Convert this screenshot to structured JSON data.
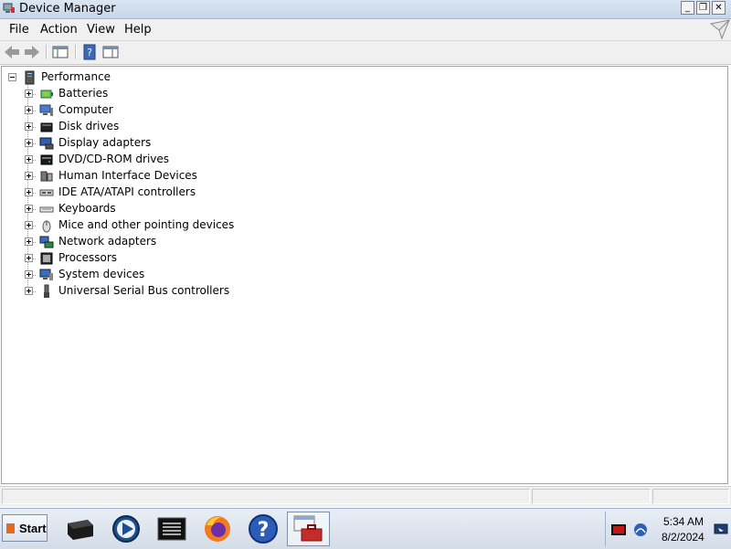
{
  "window": {
    "title": "Device Manager"
  },
  "menu": [
    "File",
    "Action",
    "View",
    "Help"
  ],
  "tree": {
    "root": {
      "label": "Performance",
      "icon": "computer-tower-icon"
    },
    "children": [
      {
        "label": "Batteries",
        "icon": "battery-icon"
      },
      {
        "label": "Computer",
        "icon": "computer-icon"
      },
      {
        "label": "Disk drives",
        "icon": "disk-drive-icon"
      },
      {
        "label": "Display adapters",
        "icon": "display-adapter-icon"
      },
      {
        "label": "DVD/CD-ROM drives",
        "icon": "dvd-drive-icon"
      },
      {
        "label": "Human Interface Devices",
        "icon": "hid-icon"
      },
      {
        "label": "IDE ATA/ATAPI controllers",
        "icon": "ide-controller-icon"
      },
      {
        "label": "Keyboards",
        "icon": "keyboard-icon"
      },
      {
        "label": "Mice and other pointing devices",
        "icon": "mouse-icon"
      },
      {
        "label": "Network adapters",
        "icon": "network-adapter-icon"
      },
      {
        "label": "Processors",
        "icon": "processor-icon"
      },
      {
        "label": "System devices",
        "icon": "system-devices-icon"
      },
      {
        "label": "Universal Serial Bus controllers",
        "icon": "usb-icon"
      }
    ]
  },
  "taskbar": {
    "start_label": "Start",
    "clock_time": "5:34 AM",
    "clock_date": "8/2/2024"
  },
  "colors": {
    "titlebar": "#c7d6ea",
    "taskbar": "#d4dce8",
    "start_logo": "#e26b1c"
  }
}
